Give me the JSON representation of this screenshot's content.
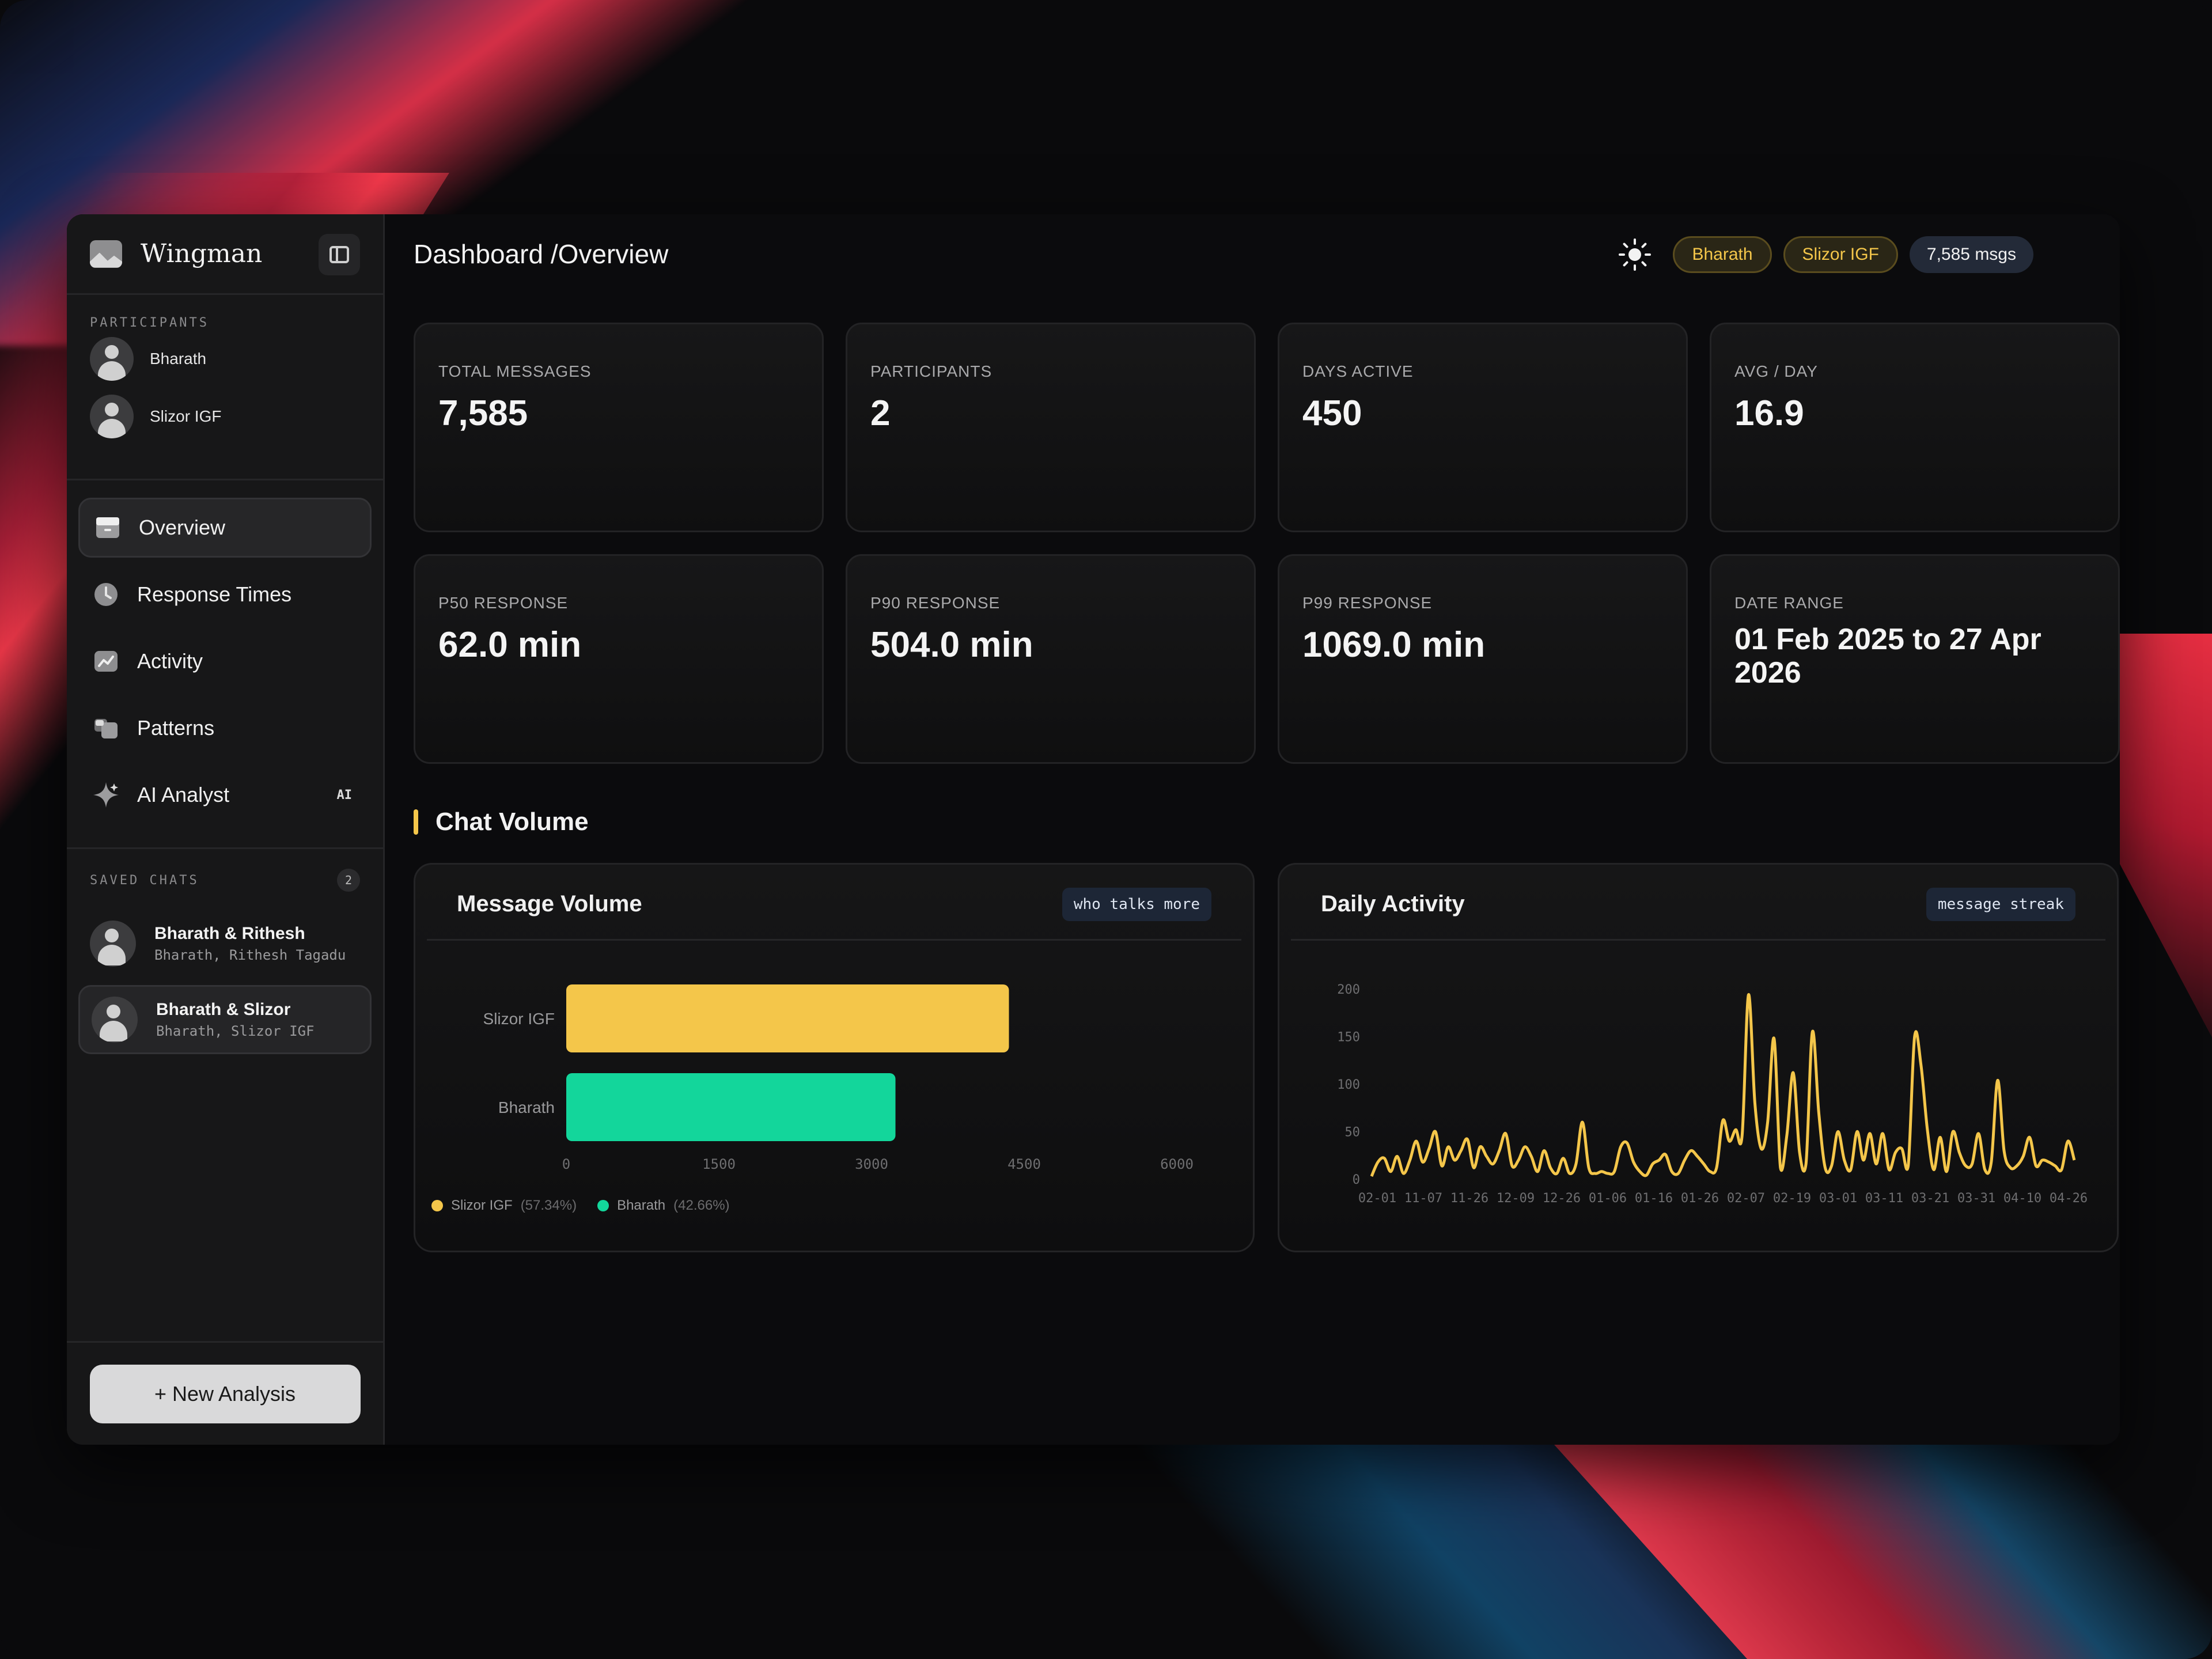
{
  "app": {
    "name": "Wingman"
  },
  "sidebar": {
    "participants_label": "PARTICIPANTS",
    "participants": [
      {
        "name": "Bharath"
      },
      {
        "name": "Slizor IGF"
      }
    ],
    "nav": [
      {
        "label": "Overview",
        "icon": "inbox-icon",
        "active": true
      },
      {
        "label": "Response Times",
        "icon": "clock-icon"
      },
      {
        "label": "Activity",
        "icon": "trend-chart-icon"
      },
      {
        "label": "Patterns",
        "icon": "grid-icon"
      },
      {
        "label": "AI Analyst",
        "icon": "sparkle-icon",
        "badge": "AI"
      }
    ],
    "saved_label": "SAVED CHATS",
    "saved_count": "2",
    "saved_chats": [
      {
        "title": "Bharath & Rithesh",
        "subtitle": "Bharath, Rithesh Tagadu"
      },
      {
        "title": "Bharath & Slizor",
        "subtitle": "Bharath, Slizor IGF",
        "active": true
      }
    ],
    "new_button": "+ New Analysis"
  },
  "header": {
    "breadcrumb": "Dashboard /Overview",
    "pills": [
      "Bharath",
      "Slizor IGF"
    ],
    "count_pill": "7,585 msgs"
  },
  "stats": [
    {
      "label": "TOTAL MESSAGES",
      "value": "7,585"
    },
    {
      "label": "PARTICIPANTS",
      "value": "2"
    },
    {
      "label": "DAYS ACTIVE",
      "value": "450"
    },
    {
      "label": "AVG / DAY",
      "value": "16.9"
    },
    {
      "label": "P50 RESPONSE",
      "value": "62.0 min"
    },
    {
      "label": "P90 RESPONSE",
      "value": "504.0 min"
    },
    {
      "label": "P99 RESPONSE",
      "value": "1069.0 min"
    },
    {
      "label": "DATE RANGE",
      "value": "01 Feb 2025 to 27 Apr 2026"
    }
  ],
  "section": {
    "title": "Chat Volume"
  },
  "colors": {
    "gold": "#F4C64A",
    "green": "#13D69B",
    "accent_bar": "#F4C64A"
  },
  "panels": {
    "volume": {
      "title": "Message Volume",
      "tag": "who talks more"
    },
    "daily": {
      "title": "Daily Activity",
      "tag": "message streak"
    }
  },
  "chart_data": [
    {
      "type": "bar",
      "orientation": "horizontal",
      "categories": [
        "Slizor IGF",
        "Bharath"
      ],
      "values": [
        4350,
        3235
      ],
      "xlim": [
        0,
        6000
      ],
      "xticks": [
        "0",
        "1500",
        "3000",
        "4500",
        "6000"
      ],
      "colors": [
        "#F4C64A",
        "#13D69B"
      ],
      "legend": [
        {
          "name": "Slizor IGF",
          "pct": "(57.34%)",
          "color": "#F4C64A"
        },
        {
          "name": "Bharath",
          "pct": "(42.66%)",
          "color": "#13D69B"
        }
      ],
      "grid": false
    },
    {
      "type": "line",
      "ylim": [
        0,
        200
      ],
      "yticks": [
        "0",
        "50",
        "100",
        "150",
        "200"
      ],
      "xticks": [
        "02-01",
        "11-07",
        "11-26",
        "12-09",
        "12-26",
        "01-06",
        "01-16",
        "01-26",
        "02-07",
        "02-19",
        "03-01",
        "03-11",
        "03-21",
        "03-31",
        "04-10",
        "04-26"
      ],
      "values": [
        3,
        18,
        22,
        8,
        24,
        6,
        20,
        40,
        18,
        32,
        50,
        14,
        34,
        20,
        30,
        42,
        12,
        34,
        24,
        16,
        30,
        48,
        14,
        20,
        34,
        24,
        8,
        30,
        12,
        6,
        22,
        6,
        16,
        60,
        12,
        6,
        8,
        6,
        8,
        34,
        38,
        18,
        8,
        4,
        16,
        20,
        26,
        8,
        6,
        20,
        30,
        24,
        16,
        8,
        12,
        62,
        40,
        52,
        46,
        194,
        80,
        32,
        60,
        148,
        12,
        46,
        112,
        28,
        16,
        155,
        70,
        12,
        14,
        50,
        20,
        10,
        50,
        20,
        48,
        16,
        48,
        10,
        28,
        32,
        14,
        150,
        120,
        52,
        10,
        44,
        8,
        50,
        28,
        14,
        16,
        48,
        10,
        18,
        104,
        30,
        12,
        14,
        24,
        44,
        14,
        20,
        18,
        14,
        10,
        40,
        20
      ],
      "color": "#F4C64A",
      "grid": false
    }
  ]
}
